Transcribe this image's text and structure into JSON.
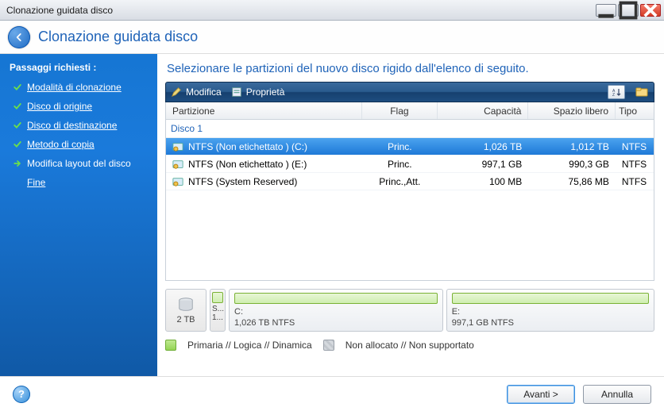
{
  "window": {
    "title": "Clonazione guidata disco"
  },
  "banner": {
    "title": "Clonazione guidata disco"
  },
  "sidebar": {
    "header": "Passaggi richiesti :",
    "items": [
      {
        "label": "Modalità di clonazione",
        "state": "done"
      },
      {
        "label": "Disco di origine",
        "state": "done"
      },
      {
        "label": "Disco di destinazione",
        "state": "done"
      },
      {
        "label": "Metodo di copia",
        "state": "done"
      },
      {
        "label": "Modifica layout del disco",
        "state": "active"
      },
      {
        "label": "Fine",
        "state": "pending"
      }
    ]
  },
  "main": {
    "title": "Selezionare le partizioni del nuovo disco rigido dall'elenco di seguito.",
    "toolbar": {
      "edit": "Modifica",
      "properties": "Proprietà"
    },
    "columns": {
      "partition": "Partizione",
      "flag": "Flag",
      "capacity": "Capacità",
      "free": "Spazio libero",
      "type": "Tipo"
    },
    "group": "Disco 1",
    "rows": [
      {
        "partition": "NTFS (Non etichettato ) (C:)",
        "flag": "Princ.",
        "capacity": "1,026 TB",
        "free": "1,012 TB",
        "type": "NTFS",
        "selected": true
      },
      {
        "partition": "NTFS (Non etichettato ) (E:)",
        "flag": "Princ.",
        "capacity": "997,1 GB",
        "free": "990,3 GB",
        "type": "NTFS",
        "selected": false
      },
      {
        "partition": "NTFS (System Reserved)",
        "flag": "Princ.,Att.",
        "capacity": "100 MB",
        "free": "75,86 MB",
        "type": "NTFS",
        "selected": false
      }
    ],
    "diskmap": {
      "disk_size": "2 TB",
      "reserved": {
        "line1": "S...",
        "line2": "1..."
      },
      "seg1": {
        "letter": "C:",
        "desc": "1,026 TB  NTFS"
      },
      "seg2": {
        "letter": "E:",
        "desc": "997,1 GB  NTFS"
      }
    },
    "legend": {
      "primary": "Primaria // Logica // Dinamica",
      "unallocated": "Non allocato // Non supportato"
    }
  },
  "footer": {
    "next": "Avanti >",
    "cancel": "Annulla"
  }
}
